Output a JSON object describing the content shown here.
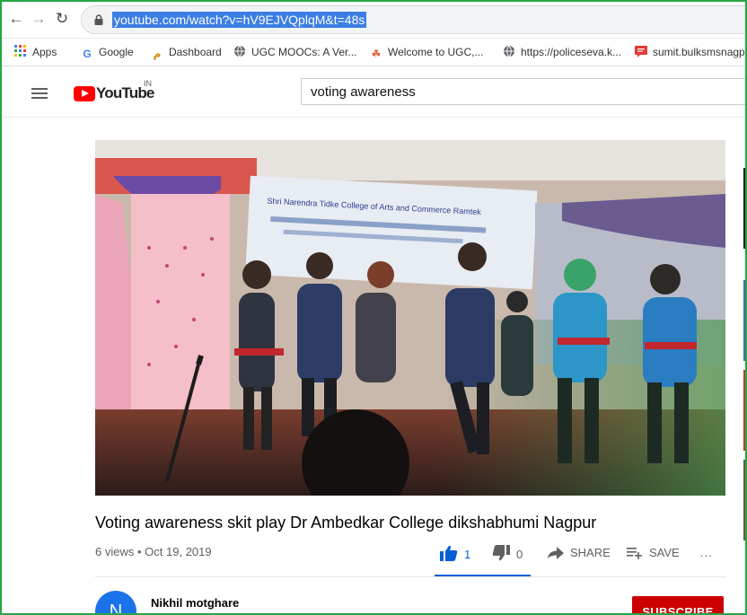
{
  "browser": {
    "url": "youtube.com/watch?v=hV9EJVQplqM&t=48s",
    "bookmarks": [
      {
        "label": "Apps",
        "icon": "apps-grid-icon"
      },
      {
        "label": "Google",
        "icon": "google-icon"
      },
      {
        "label": "Dashboard",
        "icon": "dashboard-icon"
      },
      {
        "label": "UGC MOOCs: A Ver...",
        "icon": "globe-icon"
      },
      {
        "label": "Welcome to UGC,...",
        "icon": "ugc-icon"
      },
      {
        "label": "https://policeseva.k...",
        "icon": "globe-icon"
      },
      {
        "label": "sumit.bulksmsnagp...",
        "icon": "sms-icon"
      }
    ]
  },
  "youtube": {
    "logo_text": "YouTube",
    "region": "IN",
    "search_value": "voting awareness"
  },
  "video": {
    "title": "Voting awareness skit play Dr Ambedkar College dikshabhumi Nagpur",
    "views": "6 views",
    "separator": "•",
    "date": "Oct 19, 2019",
    "likes": "1",
    "dislikes": "0",
    "share_label": "SHARE",
    "save_label": "SAVE",
    "more_label": "...",
    "banner_line1": "Shri Narendra Tidke College of Arts and Commerce Ramtek"
  },
  "channel": {
    "avatar_letter": "N",
    "name": "Nikhil motghare",
    "subscribe_label": "SUBSCRIBE"
  },
  "colors": {
    "accent": "#065fd4",
    "youtube_red": "#ff0000",
    "subscribe_red": "#cc0000",
    "frame_green": "#26a745",
    "url_selection": "#3b7ee3"
  }
}
